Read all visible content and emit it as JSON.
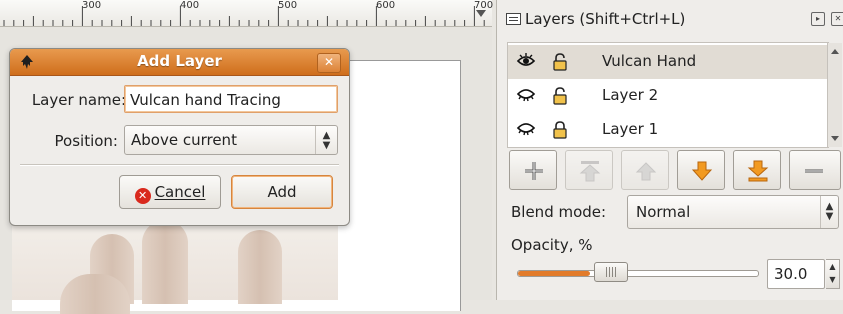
{
  "ruler": {
    "labels": [
      "300",
      "400",
      "500",
      "600",
      "700"
    ]
  },
  "dialog": {
    "title": "Add Layer",
    "close_label": "✕",
    "layer_name_label": "Layer name:",
    "layer_name_value": "Vulcan hand Tracing",
    "position_label": "Position:",
    "position_value": "Above current",
    "cancel_label": "Cancel",
    "add_label": "Add"
  },
  "panel": {
    "title": "Layers (Shift+Ctrl+L)",
    "layers": [
      {
        "name": "Vulcan Hand",
        "visible": true,
        "locked": false,
        "selected": true
      },
      {
        "name": "Layer 2",
        "visible": false,
        "locked": false,
        "selected": false
      },
      {
        "name": "Layer 1",
        "visible": false,
        "locked": true,
        "selected": false
      }
    ],
    "buttons": [
      "add-layer",
      "raise-to-top",
      "raise",
      "lower",
      "lower-to-bottom",
      "delete-layer"
    ],
    "blend_mode_label": "Blend mode:",
    "blend_mode_value": "Normal",
    "opacity_label": "Opacity, %",
    "opacity_value": "30.0",
    "opacity_fraction": 0.3
  },
  "colors": {
    "accent": "#d9782c",
    "title_bar": "#cf6e1c",
    "cancel_icon": "#d9291d"
  }
}
